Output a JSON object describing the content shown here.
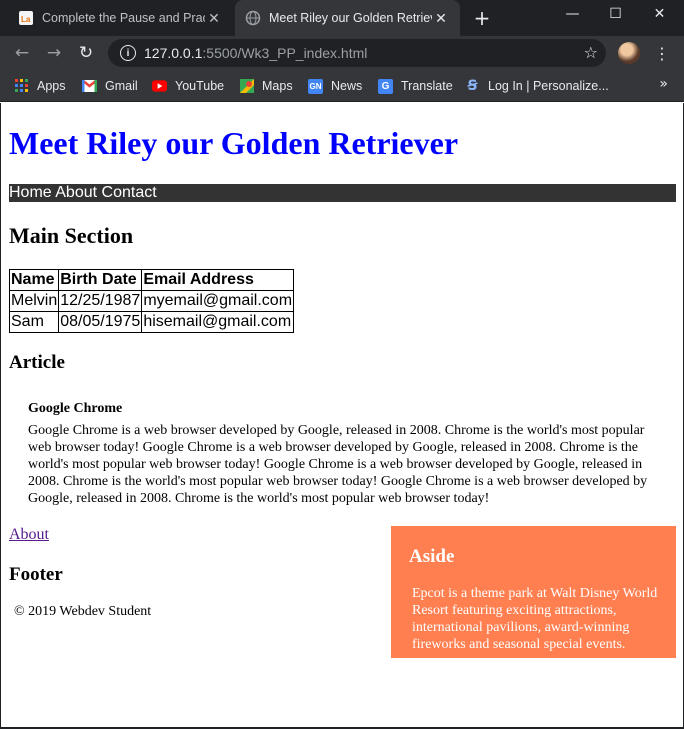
{
  "browser": {
    "tabs": [
      {
        "title": "Complete the Pause and Practice",
        "icon": "la-favicon-icon",
        "active": false
      },
      {
        "title": "Meet Riley our Golden Retriever",
        "icon": "globe-icon",
        "active": true
      }
    ],
    "new_tab": "+",
    "window_controls": {
      "minimize": "—",
      "maximize": "☐",
      "close": "✕"
    },
    "nav": {
      "back": "←",
      "forward": "→",
      "reload": "↻"
    },
    "url_host": "127.0.0.1",
    "url_path": ":5500/Wk3_PP_index.html",
    "bookmarks": [
      {
        "label": "Apps",
        "icon": "apps-grid-icon"
      },
      {
        "label": "Gmail",
        "icon": "gmail-icon"
      },
      {
        "label": "YouTube",
        "icon": "youtube-icon"
      },
      {
        "label": "Maps",
        "icon": "maps-icon"
      },
      {
        "label": "News",
        "icon": "news-icon"
      },
      {
        "label": "Translate",
        "icon": "translate-icon"
      },
      {
        "label": "Log In | Personalize...",
        "icon": "login-icon"
      }
    ],
    "bookmarks_more": "»"
  },
  "page": {
    "title": "Meet Riley our Golden Retriever",
    "nav": {
      "home": "Home",
      "about": "About",
      "contact": "Contact"
    },
    "main_heading": "Main Section",
    "table": {
      "headers": [
        "Name",
        "Birth Date",
        "Email Address"
      ],
      "rows": [
        [
          "Melvin",
          "12/25/1987",
          "myemail@gmail.com"
        ],
        [
          "Sam",
          "08/05/1975",
          "hisemail@gmail.com"
        ]
      ]
    },
    "article": {
      "heading": "Article",
      "subheading": "Google Chrome",
      "body": "Google Chrome is a web browser developed by Google, released in 2008. Chrome is the world's most popular web browser today! Google Chrome is a web browser developed by Google, released in 2008. Chrome is the world's most popular web browser today! Google Chrome is a web browser developed by Google, released in 2008. Chrome is the world's most popular web browser today! Google Chrome is a web browser developed by Google, released in 2008. Chrome is the world's most popular web browser today!"
    },
    "about_link": "About",
    "footer_heading": "Footer",
    "copyright": "© 2019 Webdev Student",
    "aside": {
      "heading": "Aside",
      "body": "Epcot is a theme park at Walt Disney World Resort featuring exciting attractions, international pavilions, award-winning fireworks and seasonal special events."
    }
  },
  "colors": {
    "title": "#0000ff",
    "nav_bg": "#333333",
    "aside_bg": "#ff7f50",
    "chrome_dark": "#202124",
    "chrome_toolbar": "#35363a"
  }
}
